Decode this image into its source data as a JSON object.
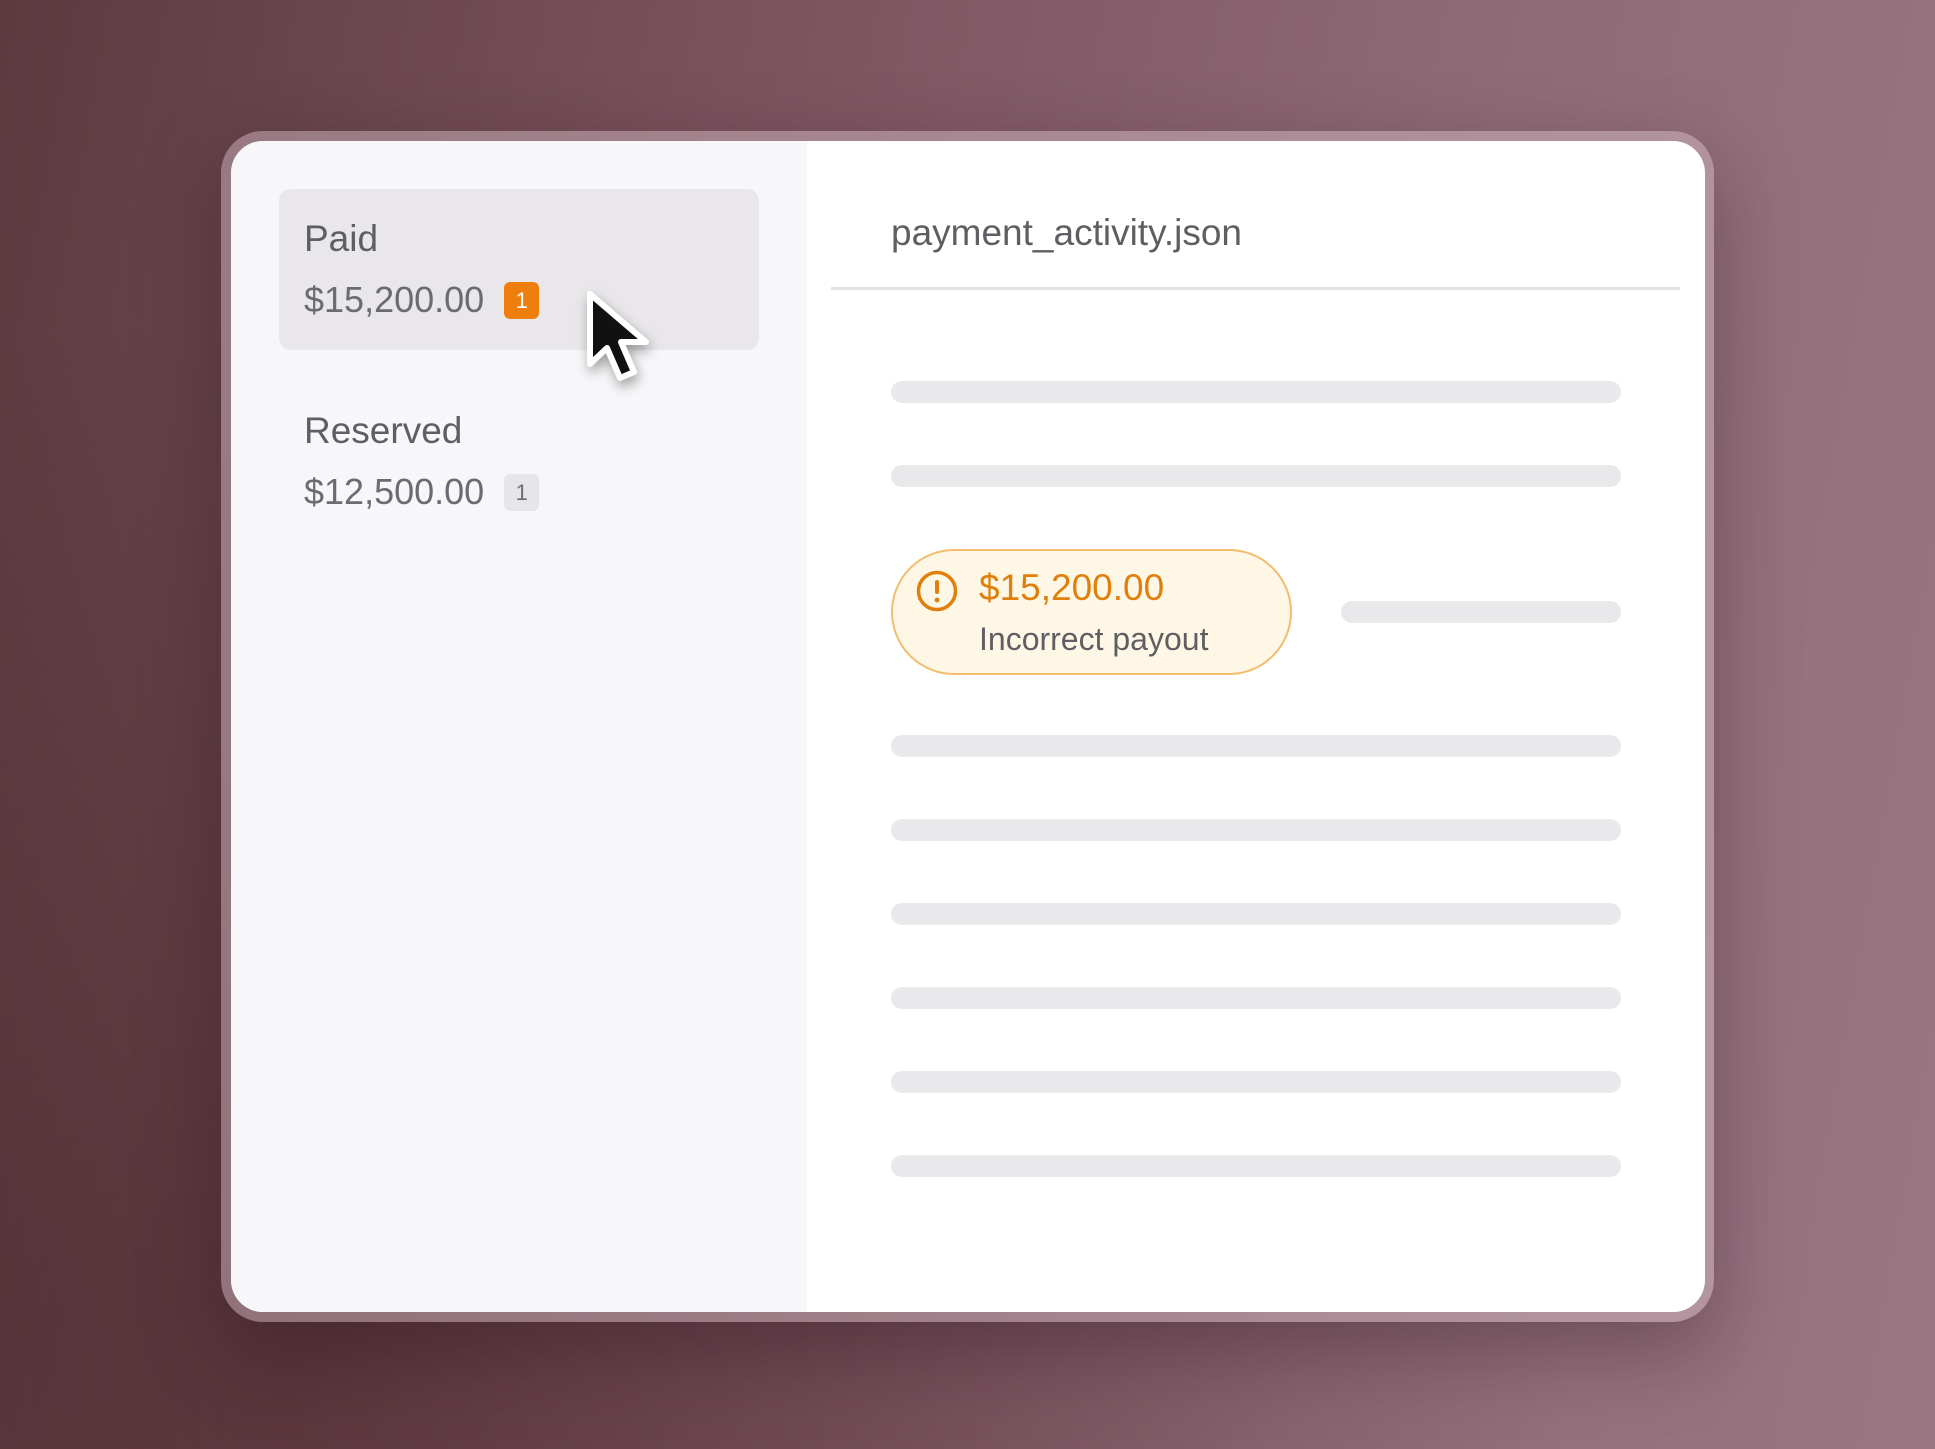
{
  "sidebar": {
    "items": [
      {
        "label": "Paid",
        "amount": "$15,200.00",
        "count": "1",
        "selected": true,
        "badge_color": "#ee7e0e"
      },
      {
        "label": "Reserved",
        "amount": "$12,500.00",
        "count": "1",
        "selected": false,
        "badge_color": "#e7e5e8"
      }
    ]
  },
  "main": {
    "file_title": "payment_activity.json",
    "alert": {
      "icon": "exclamation-circle-icon",
      "amount": "$15,200.00",
      "message": "Incorrect payout",
      "accent_color": "#e07f0c"
    }
  },
  "cursor": {
    "icon": "mouse-pointer-icon"
  },
  "colors": {
    "background": "#7a535e",
    "sidebar_bg": "#f7f6f8",
    "selected_bg": "#e9e7ea",
    "skeleton": "#e9e8eb",
    "alert_bg": "#fff7e6",
    "alert_border": "#f2bd6d"
  }
}
